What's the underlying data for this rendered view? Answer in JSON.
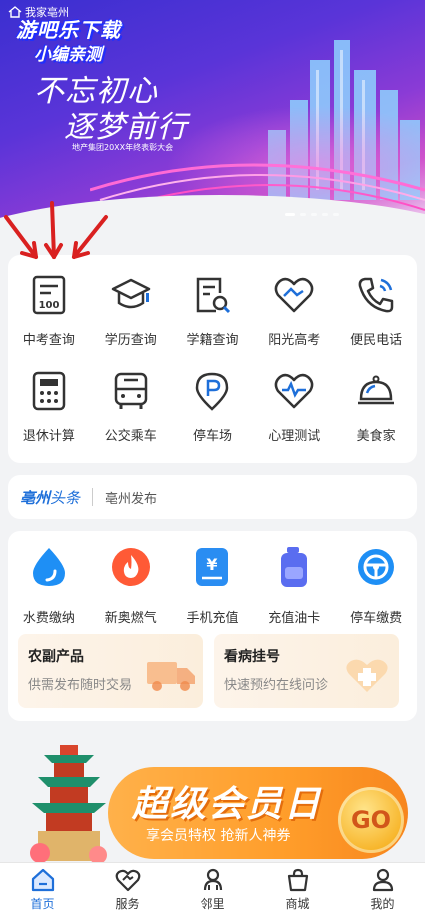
{
  "banner": {
    "location": "我家亳州",
    "watermark_line1": "游吧乐下载",
    "watermark_line2": "小编亲测",
    "slogan_line1": "不忘初心",
    "slogan_line2": "逐梦前行",
    "subtitle": "地产集团20XX年终表彰大会"
  },
  "quick_services": [
    {
      "label": "中考查询",
      "icon": "exam-score-icon"
    },
    {
      "label": "学历查询",
      "icon": "graduation-cap-icon"
    },
    {
      "label": "学籍查询",
      "icon": "document-search-icon"
    },
    {
      "label": "阳光高考",
      "icon": "heart-shield-icon"
    },
    {
      "label": "便民电话",
      "icon": "phone-icon"
    },
    {
      "label": "退休计算",
      "icon": "calculator-icon"
    },
    {
      "label": "公交乘车",
      "icon": "bus-icon"
    },
    {
      "label": "停车场",
      "icon": "parking-icon"
    },
    {
      "label": "心理测试",
      "icon": "heart-pulse-icon"
    },
    {
      "label": "美食家",
      "icon": "food-cloche-icon"
    }
  ],
  "news": {
    "logo_part1": "亳州",
    "logo_part2": "头条",
    "text": "亳州发布"
  },
  "payments": [
    {
      "label": "水费缴纳",
      "icon": "water-drop-icon",
      "color": "#1e8ff5"
    },
    {
      "label": "新奥燃气",
      "icon": "flame-icon",
      "color": "#ff5a36"
    },
    {
      "label": "手机充值",
      "icon": "yuan-icon",
      "color": "#2a8df2"
    },
    {
      "label": "充值油卡",
      "icon": "oil-can-icon",
      "color": "#5a6df0"
    },
    {
      "label": "停车缴费",
      "icon": "steering-wheel-icon",
      "color": "#1e8ff5"
    }
  ],
  "promos": [
    {
      "title": "农副产品",
      "subtitle": "供需发布随时交易"
    },
    {
      "title": "看病挂号",
      "subtitle": "快速预约在线问诊"
    }
  ],
  "vip": {
    "title": "超级会员日",
    "subtitle": "享会员特权 抢新人神券",
    "go": "GO"
  },
  "tabs": [
    {
      "label": "首页",
      "icon": "home-icon"
    },
    {
      "label": "服务",
      "icon": "service-heart-icon"
    },
    {
      "label": "邻里",
      "icon": "neighbors-icon"
    },
    {
      "label": "商城",
      "icon": "shopping-bag-icon"
    },
    {
      "label": "我的",
      "icon": "profile-icon"
    }
  ],
  "colors": {
    "accent": "#1e6fd9",
    "icon_stroke": "#333333"
  }
}
